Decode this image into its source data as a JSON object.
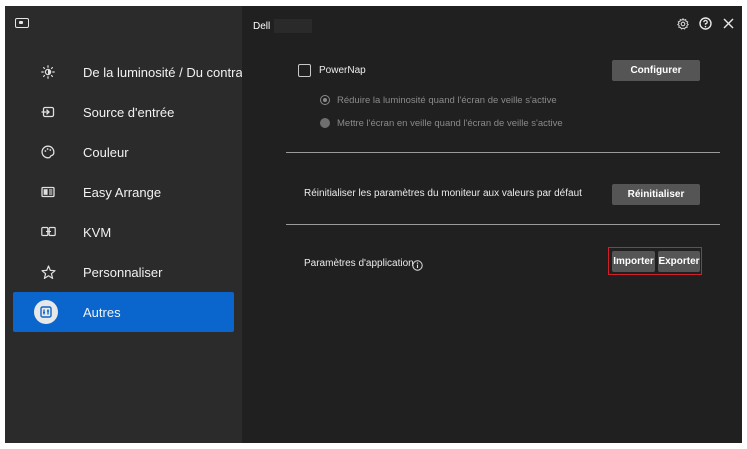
{
  "window": {
    "brand": "Dell",
    "icons": {
      "app": "monitor-icon",
      "settings": "gear-icon",
      "help": "help-icon",
      "close": "close-icon"
    }
  },
  "sidebar": {
    "items": [
      {
        "label": "De la luminosité / Du contraste",
        "icon": "brightness-icon",
        "active": false
      },
      {
        "label": "Source d'entrée",
        "icon": "input-source-icon",
        "active": false
      },
      {
        "label": "Couleur",
        "icon": "color-icon",
        "active": false
      },
      {
        "label": "Easy Arrange",
        "icon": "easy-arrange-icon",
        "active": false
      },
      {
        "label": "KVM",
        "icon": "kvm-icon",
        "active": false
      },
      {
        "label": "Personnaliser",
        "icon": "star-icon",
        "active": false
      },
      {
        "label": "Autres",
        "icon": "others-icon",
        "active": true
      }
    ],
    "active_color": "#0a66cc"
  },
  "main": {
    "powernap": {
      "label": "PowerNap",
      "checked": false,
      "configure_label": "Configurer",
      "options": [
        {
          "label": "Réduire la luminosité quand l'écran de veille s'active",
          "selected": true
        },
        {
          "label": "Mettre l'écran en veille quand l'écran de veille s'active",
          "selected": false
        }
      ]
    },
    "reset": {
      "label": "Réinitialiser les paramètres du moniteur aux valeurs par défaut",
      "button_label": "Réinitialiser"
    },
    "app_settings": {
      "label": "Paramètres d'application",
      "info_icon": "info-icon",
      "import_label": "Importer",
      "export_label": "Exporter",
      "highlight_color": "#d0202a"
    }
  }
}
